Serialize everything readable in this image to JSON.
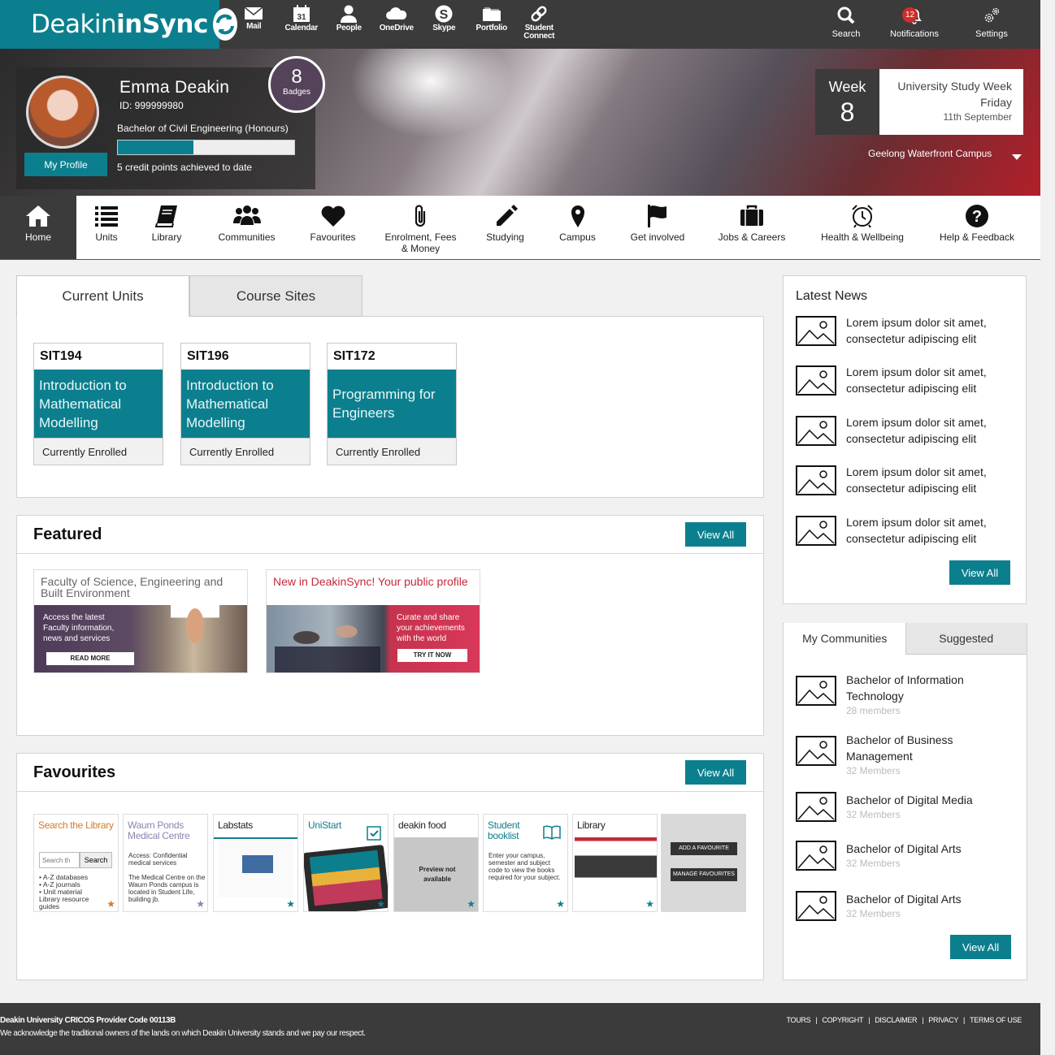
{
  "brand": {
    "logo_text_a": "Deakin",
    "logo_text_b": "inSync"
  },
  "apps": [
    "Mail",
    "Calendar",
    "People",
    "OneDrive",
    "Skype",
    "Portfolio",
    "Student Connect"
  ],
  "calendar_day": "31",
  "right_apps": {
    "search": "Search",
    "notifications": "Notifications",
    "notification_count": "12",
    "settings": "Settings"
  },
  "profile": {
    "name": "Emma Deakin",
    "id": "ID: 999999980",
    "degree": "Bachelor of Civil Engineering (Honours)",
    "progress_fraction": 0.43,
    "credits": "5 credit points achieved to date",
    "my_profile": "My Profile",
    "badge_count": "8",
    "badge_label": "Badges"
  },
  "week": {
    "label": "Week",
    "number": "8",
    "period": "University Study Week",
    "day": "Friday",
    "date": "11th September"
  },
  "campus": "Geelong Waterfront Campus",
  "nav": [
    "Home",
    "Units",
    "Library",
    "Communities",
    "Favourites",
    "Enrolment, Fees & Money",
    "Studying",
    "Campus",
    "Get involved",
    "Jobs & Careers",
    "Health & Wellbeing",
    "Help & Feedback"
  ],
  "units_tabs": [
    "Current Units",
    "Course Sites"
  ],
  "units": [
    {
      "code": "SIT194",
      "title": "Introduction to Mathematical Modelling",
      "status": "Currently Enrolled"
    },
    {
      "code": "SIT196",
      "title": "Introduction to Mathematical Modelling",
      "status": "Currently Enrolled"
    },
    {
      "code": "SIT172",
      "title": "Programming for Engineers",
      "status": "Currently Enrolled"
    }
  ],
  "featured": {
    "title": "Featured",
    "view_all": "View All",
    "items": [
      {
        "heading": "Faculty of Science, Engineering and Built Environment",
        "text": "Access the latest Faculty information, news and services",
        "button": "READ MORE"
      },
      {
        "heading": "New in DeakinSync! Your public profile",
        "text": "Curate and share your achievements with the world",
        "button": "TRY IT NOW"
      }
    ]
  },
  "favourites": {
    "title": "Favourites",
    "view_all": "View All",
    "items": [
      {
        "title": "Search the Library",
        "body": "• A-Z databases\n• A-Z journals\n• Unit material\n  Library resource\n  guides",
        "search_placeholder": "Search th",
        "search_button": "Search"
      },
      {
        "title": "Waurn Ponds Medical Centre",
        "body": "Access: Confidential medical services\n\nThe Medical Centre on the Waurn Ponds campus is located in Student Life, building jb."
      },
      {
        "title": "Labstats",
        "body": ""
      },
      {
        "title": "UniStart",
        "body": ""
      },
      {
        "title": "deakin food",
        "body": "Preview not available"
      },
      {
        "title": "Student booklist",
        "body": "Enter your campus, semester and subject code to view the books required for your subject."
      },
      {
        "title": "Library",
        "body": ""
      }
    ],
    "add_favourite": "ADD A FAVOURITE",
    "manage_favourites": "MANAGE FAVOURITES"
  },
  "news": {
    "title": "Latest News",
    "items": [
      "Lorem ipsum dolor sit amet, consectetur adipiscing elit",
      "Lorem ipsum dolor sit amet, consectetur adipiscing elit",
      "Lorem ipsum dolor sit amet, consectetur adipiscing elit",
      "Lorem ipsum dolor sit amet, consectetur adipiscing elit",
      "Lorem ipsum dolor sit amet, consectetur adipiscing elit"
    ],
    "view_all": "View All"
  },
  "communities": {
    "tabs": [
      "My Communities",
      "Suggested"
    ],
    "items": [
      {
        "name": "Bachelor of Information Technology",
        "members": "28 members"
      },
      {
        "name": "Bachelor of Business Management",
        "members": "32 Members"
      },
      {
        "name": "Bachelor of Digital Media",
        "members": "32 Members"
      },
      {
        "name": "Bachelor of Digital Arts",
        "members": "32 Members"
      },
      {
        "name": "Bachelor of Digital Arts",
        "members": "32 Members"
      }
    ],
    "view_all": "View All"
  },
  "footer": {
    "line1": "Deakin University CRICOS Provider Code 00113B",
    "line2": "We acknowledge the traditional owners of the lands on which Deakin University stands and we pay our respect.",
    "links": [
      "TOURS",
      "COPYRIGHT",
      "DISCLAIMER",
      "PRIVACY",
      "TERMS OF USE"
    ]
  },
  "colors": {
    "accent": "#0c7f8e",
    "dark": "#3b3b3b",
    "badge": "#54435a",
    "notification": "#d12b2b"
  }
}
